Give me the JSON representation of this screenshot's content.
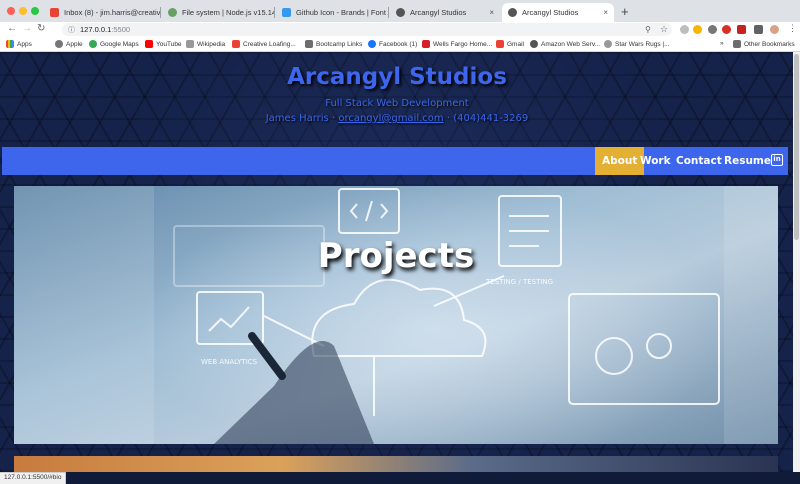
{
  "browser": {
    "tabs": [
      {
        "title": "Inbox (8) - jim.harris@creativ",
        "favicon_color": "#ea4335"
      },
      {
        "title": "File system | Node.js v15.14.0",
        "favicon_color": "#68a063"
      },
      {
        "title": "Github Icon - Brands | Font Aw",
        "favicon_color": "#339af0"
      },
      {
        "title": "Arcangyl Studios",
        "favicon_color": "#555555"
      },
      {
        "title": "Arcangyl Studios",
        "favicon_color": "#555555"
      }
    ],
    "new_tab": "+",
    "close_glyph": "×",
    "url_host": "127.0.0.1",
    "url_port": ":5500",
    "bookmarks": [
      "Apps",
      "Apple",
      "Google Maps",
      "YouTube",
      "Wikipedia",
      "Creative Loafing...",
      "Bootcamp Links",
      "Facebook (1)",
      "Wells Fargo Home...",
      "Gmail",
      "Amazon Web Serv...",
      "Star Wars Rugs |...",
      "Other Bookmarks"
    ],
    "bookmarks_more": "»",
    "status_url": "127.0.0.1:5500/#bio"
  },
  "site": {
    "brand": "Arcangyl Studios",
    "tagline": "Full Stack Web Development",
    "contact_name": "James Harris",
    "separator": "·",
    "contact_email": "orcangyl@gmail.com",
    "contact_phone": "(404)441-3269",
    "nav": [
      "About",
      "Work",
      "Contact",
      "Resume"
    ],
    "nav_active": "About",
    "linkedin_glyph": "in",
    "hero_title": "Projects"
  },
  "colors": {
    "accent": "#3d66ec",
    "active_nav": "#e3b033",
    "background": "#15224a"
  }
}
